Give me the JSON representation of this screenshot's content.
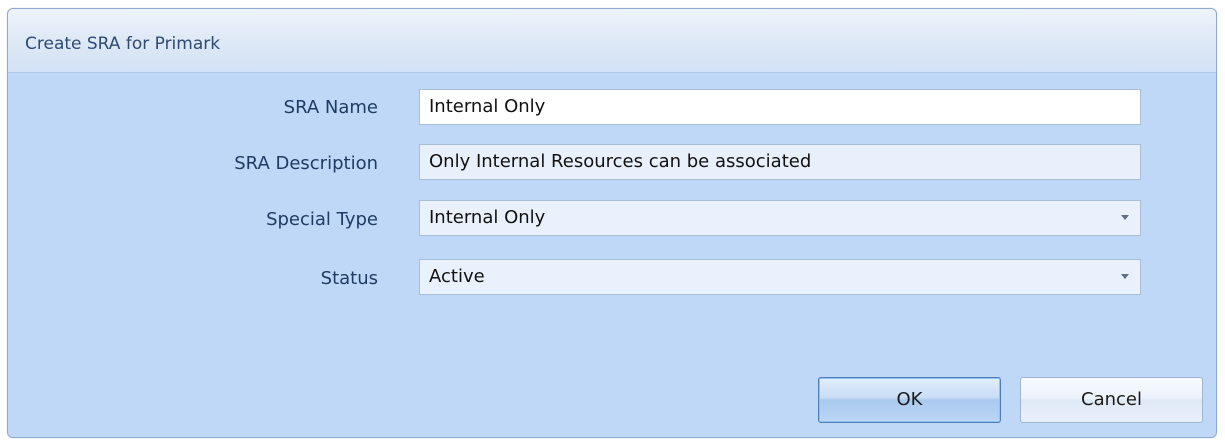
{
  "window": {
    "title": "Create SRA for Primark"
  },
  "form": {
    "sra_name": {
      "label": "SRA Name",
      "value": "Internal Only"
    },
    "sra_description": {
      "label": "SRA Description",
      "value": "Only Internal Resources can be associated"
    },
    "special_type": {
      "label": "Special Type",
      "value": "Internal Only",
      "icon": "chevron-down-icon"
    },
    "status": {
      "label": "Status",
      "value": "Active",
      "icon": "chevron-down-icon"
    }
  },
  "buttons": {
    "ok_label": "OK",
    "cancel_label": "Cancel"
  },
  "colors": {
    "dialog_background": "#bfd8f7",
    "title_text": "#2f4a72",
    "label_text": "#1f3b64",
    "field_border": "#a9bfd8"
  }
}
